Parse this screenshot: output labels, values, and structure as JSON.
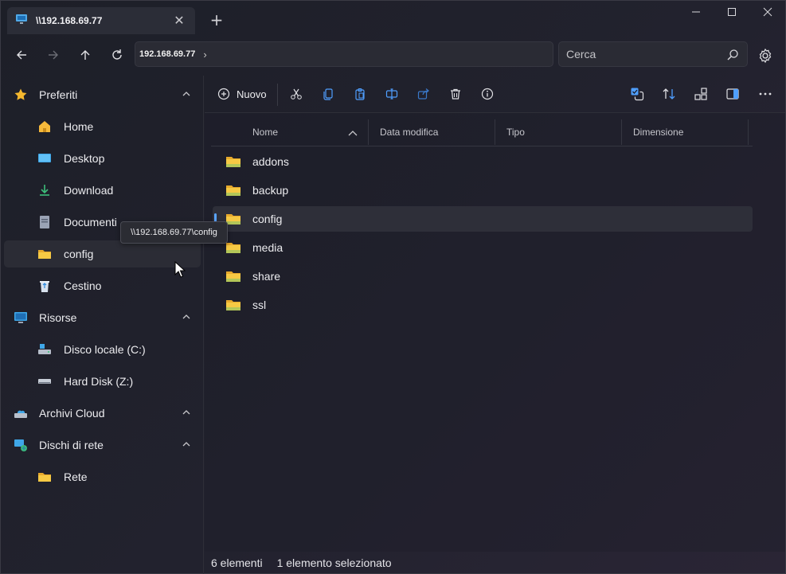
{
  "window": {
    "tab_title": "\\\\192.168.69.77",
    "new_tab": "+",
    "close_tab": "✕"
  },
  "nav": {
    "address": "192.168.69.77",
    "search_placeholder": "Cerca"
  },
  "sidebar": {
    "sections": [
      {
        "label": "Preferiti",
        "icon": "star-icon"
      },
      {
        "label": "Risorse",
        "icon": "computer-icon"
      },
      {
        "label": "Archivi Cloud",
        "icon": "cloud-icon"
      },
      {
        "label": "Dischi di rete",
        "icon": "network-icon"
      }
    ],
    "favorites": [
      {
        "label": "Home",
        "icon": "home-icon"
      },
      {
        "label": "Desktop",
        "icon": "desktop-icon"
      },
      {
        "label": "Download",
        "icon": "download-icon"
      },
      {
        "label": "Documenti",
        "icon": "documents-icon"
      },
      {
        "label": "config",
        "icon": "folder-icon"
      },
      {
        "label": "Cestino",
        "icon": "recycle-bin-icon"
      }
    ],
    "drives": [
      {
        "label": "Disco locale (C:)",
        "icon": "local-disk-icon"
      },
      {
        "label": "Hard Disk (Z:)",
        "icon": "hard-disk-icon"
      }
    ],
    "network": [
      {
        "label": "Rete",
        "icon": "folder-icon"
      }
    ]
  },
  "toolbar": {
    "new_label": "Nuovo"
  },
  "list": {
    "columns": [
      "Nome",
      "Data modifica",
      "Tipo",
      "Dimensione"
    ],
    "items": [
      {
        "name": "addons"
      },
      {
        "name": "backup"
      },
      {
        "name": "config"
      },
      {
        "name": "media"
      },
      {
        "name": "share"
      },
      {
        "name": "ssl"
      }
    ],
    "selected_index": 2
  },
  "tooltip": "\\\\192.168.69.77\\config",
  "status": {
    "count": "6 elementi",
    "selection": "1 elemento selezionato"
  },
  "colors": {
    "accent": "#5aa4ff",
    "folder": "#f6c944",
    "star": "#f5b82e"
  }
}
